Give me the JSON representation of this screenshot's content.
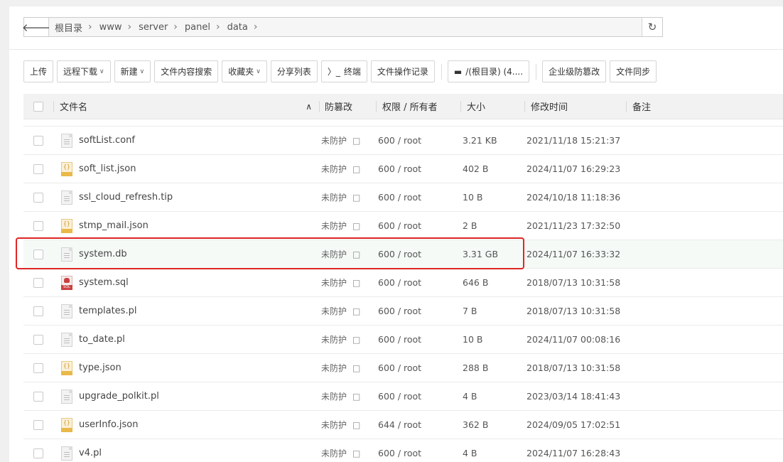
{
  "breadcrumb": {
    "items": [
      "根目录",
      "www",
      "server",
      "panel",
      "data"
    ]
  },
  "toolbar": {
    "upload": "上传",
    "remote_download": "远程下载",
    "new": "新建",
    "content_search": "文件内容搜索",
    "favorites": "收藏夹",
    "share_list": "分享列表",
    "terminal": "终端",
    "operation_log": "文件操作记录",
    "disk": "/(根目录) (4....",
    "enterprise_tamper": "企业级防篡改",
    "file_sync": "文件同步"
  },
  "table": {
    "headers": {
      "name": "文件名",
      "tamper": "防篡改",
      "perm": "权限 / 所有者",
      "size": "大小",
      "mtime": "修改时间",
      "note": "备注"
    },
    "rows": [
      {
        "icon": "text",
        "name": "softList.conf",
        "protect": "未防护",
        "perm": "600 / root",
        "size": "3.21 KB",
        "time": "2021/11/18 15:21:37"
      },
      {
        "icon": "json",
        "name": "soft_list.json",
        "protect": "未防护",
        "perm": "600 / root",
        "size": "402 B",
        "time": "2024/11/07 16:29:23"
      },
      {
        "icon": "text",
        "name": "ssl_cloud_refresh.tip",
        "protect": "未防护",
        "perm": "600 / root",
        "size": "10 B",
        "time": "2024/10/18 11:18:36"
      },
      {
        "icon": "json",
        "name": "stmp_mail.json",
        "protect": "未防护",
        "perm": "600 / root",
        "size": "2 B",
        "time": "2021/11/23 17:32:50"
      },
      {
        "icon": "text",
        "name": "system.db",
        "protect": "未防护",
        "perm": "600 / root",
        "size": "3.31 GB",
        "time": "2024/11/07 16:33:32"
      },
      {
        "icon": "sql",
        "name": "system.sql",
        "protect": "未防护",
        "perm": "600 / root",
        "size": "646 B",
        "time": "2018/07/13 10:31:58"
      },
      {
        "icon": "text",
        "name": "templates.pl",
        "protect": "未防护",
        "perm": "600 / root",
        "size": "7 B",
        "time": "2018/07/13 10:31:58"
      },
      {
        "icon": "text",
        "name": "to_date.pl",
        "protect": "未防护",
        "perm": "600 / root",
        "size": "10 B",
        "time": "2024/11/07 00:08:16"
      },
      {
        "icon": "json",
        "name": "type.json",
        "protect": "未防护",
        "perm": "600 / root",
        "size": "288 B",
        "time": "2018/07/13 10:31:58"
      },
      {
        "icon": "text",
        "name": "upgrade_polkit.pl",
        "protect": "未防护",
        "perm": "600 / root",
        "size": "4 B",
        "time": "2023/03/14 18:41:43"
      },
      {
        "icon": "json",
        "name": "userInfo.json",
        "protect": "未防护",
        "perm": "644 / root",
        "size": "362 B",
        "time": "2024/09/05 17:02:51"
      },
      {
        "icon": "text",
        "name": "v4.pl",
        "protect": "未防护",
        "perm": "600 / root",
        "size": "4 B",
        "time": "2024/11/07 16:28:43"
      }
    ]
  },
  "colors": {
    "highlight_border": "#e02525",
    "header_bg": "#f2f2f2",
    "row_highlight_bg": "#f5faf7"
  }
}
